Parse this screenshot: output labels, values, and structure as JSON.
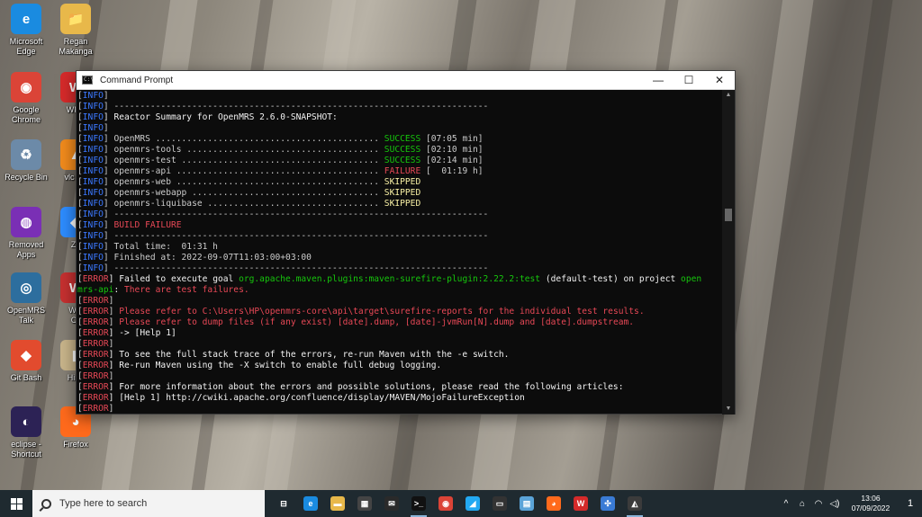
{
  "desktop": {
    "icons": [
      {
        "label": "Microsoft\nEdge",
        "glyph": "e",
        "color": "#1a8be0"
      },
      {
        "label": "Regan\nMakanga",
        "glyph": "📁",
        "color": "#e8b84a"
      },
      {
        "label": "Google\nChrome",
        "glyph": "◉",
        "color": "#db4437"
      },
      {
        "label": "WPS",
        "glyph": "W",
        "color": "#d52a2a"
      },
      {
        "label": "Recycle Bin",
        "glyph": "♻",
        "color": "#6c8aa8"
      },
      {
        "label": "vlc - S",
        "glyph": "▲",
        "color": "#f08a1c"
      },
      {
        "label": "Removed\nApps",
        "glyph": "◍",
        "color": "#7a2fb5"
      },
      {
        "label": "Zo",
        "glyph": "◆",
        "color": "#2d8cff"
      },
      {
        "label": "OpenMRS\nTalk",
        "glyph": "◎",
        "color": "#2d6e9e"
      },
      {
        "label": "WO\nCli",
        "glyph": "W",
        "color": "#c53030"
      },
      {
        "label": "Git Bash",
        "glyph": "◆",
        "color": "#e24b2e"
      },
      {
        "label": "Hibe",
        "glyph": "▮",
        "color": "#c8b48a"
      },
      {
        "label": "eclipse -\nShortcut",
        "glyph": "◐",
        "color": "#2c2255"
      },
      {
        "label": "Firefox",
        "glyph": "◕",
        "color": "#ff6a1c"
      }
    ]
  },
  "window": {
    "title": "Command Prompt",
    "minimize": "—",
    "maximize": "☐",
    "close": "✕"
  },
  "console": {
    "lines": [
      {
        "parts": [
          {
            "t": "[",
            "c": "grey"
          },
          {
            "t": "INFO",
            "c": "info"
          },
          {
            "t": "]",
            "c": "grey"
          }
        ]
      },
      {
        "parts": [
          {
            "t": "[",
            "c": "grey"
          },
          {
            "t": "INFO",
            "c": "info"
          },
          {
            "t": "] ------------------------------------------------------------------------",
            "c": "grey"
          }
        ]
      },
      {
        "parts": [
          {
            "t": "[",
            "c": "grey"
          },
          {
            "t": "INFO",
            "c": "info"
          },
          {
            "t": "] Reactor Summary for OpenMRS 2.6.0-SNAPSHOT:",
            "c": "white"
          }
        ]
      },
      {
        "parts": [
          {
            "t": "[",
            "c": "grey"
          },
          {
            "t": "INFO",
            "c": "info"
          },
          {
            "t": "]",
            "c": "grey"
          }
        ]
      },
      {
        "parts": [
          {
            "t": "[",
            "c": "grey"
          },
          {
            "t": "INFO",
            "c": "info"
          },
          {
            "t": "] OpenMRS ........................................... ",
            "c": "grey"
          },
          {
            "t": "SUCCESS",
            "c": "success"
          },
          {
            "t": " [07:05 min]",
            "c": "grey"
          }
        ]
      },
      {
        "parts": [
          {
            "t": "[",
            "c": "grey"
          },
          {
            "t": "INFO",
            "c": "info"
          },
          {
            "t": "] openmrs-tools ..................................... ",
            "c": "grey"
          },
          {
            "t": "SUCCESS",
            "c": "success"
          },
          {
            "t": " [02:10 min]",
            "c": "grey"
          }
        ]
      },
      {
        "parts": [
          {
            "t": "[",
            "c": "grey"
          },
          {
            "t": "INFO",
            "c": "info"
          },
          {
            "t": "] openmrs-test ...................................... ",
            "c": "grey"
          },
          {
            "t": "SUCCESS",
            "c": "success"
          },
          {
            "t": " [02:14 min]",
            "c": "grey"
          }
        ]
      },
      {
        "parts": [
          {
            "t": "[",
            "c": "grey"
          },
          {
            "t": "INFO",
            "c": "info"
          },
          {
            "t": "] openmrs-api ....................................... ",
            "c": "grey"
          },
          {
            "t": "FAILURE",
            "c": "red"
          },
          {
            "t": " [  01:19 h]",
            "c": "grey"
          }
        ]
      },
      {
        "parts": [
          {
            "t": "[",
            "c": "grey"
          },
          {
            "t": "INFO",
            "c": "info"
          },
          {
            "t": "] openmrs-web ....................................... ",
            "c": "grey"
          },
          {
            "t": "SKIPPED",
            "c": "warn"
          }
        ]
      },
      {
        "parts": [
          {
            "t": "[",
            "c": "grey"
          },
          {
            "t": "INFO",
            "c": "info"
          },
          {
            "t": "] openmrs-webapp .................................... ",
            "c": "grey"
          },
          {
            "t": "SKIPPED",
            "c": "warn"
          }
        ]
      },
      {
        "parts": [
          {
            "t": "[",
            "c": "grey"
          },
          {
            "t": "INFO",
            "c": "info"
          },
          {
            "t": "] openmrs-liquibase ................................. ",
            "c": "grey"
          },
          {
            "t": "SKIPPED",
            "c": "warn"
          }
        ]
      },
      {
        "parts": [
          {
            "t": "[",
            "c": "grey"
          },
          {
            "t": "INFO",
            "c": "info"
          },
          {
            "t": "] ------------------------------------------------------------------------",
            "c": "grey"
          }
        ]
      },
      {
        "parts": [
          {
            "t": "[",
            "c": "grey"
          },
          {
            "t": "INFO",
            "c": "info"
          },
          {
            "t": "] ",
            "c": "grey"
          },
          {
            "t": "BUILD FAILURE",
            "c": "red"
          }
        ]
      },
      {
        "parts": [
          {
            "t": "[",
            "c": "grey"
          },
          {
            "t": "INFO",
            "c": "info"
          },
          {
            "t": "] ------------------------------------------------------------------------",
            "c": "grey"
          }
        ]
      },
      {
        "parts": [
          {
            "t": "[",
            "c": "grey"
          },
          {
            "t": "INFO",
            "c": "info"
          },
          {
            "t": "] Total time:  01:31 h",
            "c": "grey"
          }
        ]
      },
      {
        "parts": [
          {
            "t": "[",
            "c": "grey"
          },
          {
            "t": "INFO",
            "c": "info"
          },
          {
            "t": "] Finished at: 2022-09-07T11:03:00+03:00",
            "c": "grey"
          }
        ]
      },
      {
        "parts": [
          {
            "t": "[",
            "c": "grey"
          },
          {
            "t": "INFO",
            "c": "info"
          },
          {
            "t": "] ------------------------------------------------------------------------",
            "c": "grey"
          }
        ]
      },
      {
        "parts": [
          {
            "t": "[",
            "c": "grey"
          },
          {
            "t": "ERROR",
            "c": "error"
          },
          {
            "t": "] Failed to execute goal ",
            "c": "white"
          },
          {
            "t": "org.apache.maven.plugins:maven-surefire-plugin:2.22.2:test",
            "c": "green"
          },
          {
            "t": " (default-test) on project ",
            "c": "white"
          },
          {
            "t": "open",
            "c": "green"
          }
        ]
      },
      {
        "parts": [
          {
            "t": "mrs-api",
            "c": "green"
          },
          {
            "t": ": ",
            "c": "white"
          },
          {
            "t": "There are test failures.",
            "c": "red"
          }
        ]
      },
      {
        "parts": [
          {
            "t": "[",
            "c": "grey"
          },
          {
            "t": "ERROR",
            "c": "error"
          },
          {
            "t": "]",
            "c": "grey"
          }
        ]
      },
      {
        "parts": [
          {
            "t": "[",
            "c": "grey"
          },
          {
            "t": "ERROR",
            "c": "error"
          },
          {
            "t": "] ",
            "c": "grey"
          },
          {
            "t": "Please refer to C:\\Users\\HP\\openmrs-core\\api\\target\\surefire-reports for the individual test results.",
            "c": "red"
          }
        ]
      },
      {
        "parts": [
          {
            "t": "[",
            "c": "grey"
          },
          {
            "t": "ERROR",
            "c": "error"
          },
          {
            "t": "] ",
            "c": "grey"
          },
          {
            "t": "Please refer to dump files (if any exist) [date].dump, [date]-jvmRun[N].dump and [date].dumpstream.",
            "c": "red"
          }
        ]
      },
      {
        "parts": [
          {
            "t": "[",
            "c": "grey"
          },
          {
            "t": "ERROR",
            "c": "error"
          },
          {
            "t": "] -> [Help 1]",
            "c": "white"
          }
        ]
      },
      {
        "parts": [
          {
            "t": "[",
            "c": "grey"
          },
          {
            "t": "ERROR",
            "c": "error"
          },
          {
            "t": "]",
            "c": "grey"
          }
        ]
      },
      {
        "parts": [
          {
            "t": "[",
            "c": "grey"
          },
          {
            "t": "ERROR",
            "c": "error"
          },
          {
            "t": "] To see the full stack trace of the errors, re-run Maven with the -e switch.",
            "c": "white"
          }
        ]
      },
      {
        "parts": [
          {
            "t": "[",
            "c": "grey"
          },
          {
            "t": "ERROR",
            "c": "error"
          },
          {
            "t": "] Re-run Maven using the -X switch to enable full debug logging.",
            "c": "white"
          }
        ]
      },
      {
        "parts": [
          {
            "t": "[",
            "c": "grey"
          },
          {
            "t": "ERROR",
            "c": "error"
          },
          {
            "t": "]",
            "c": "grey"
          }
        ]
      },
      {
        "parts": [
          {
            "t": "[",
            "c": "grey"
          },
          {
            "t": "ERROR",
            "c": "error"
          },
          {
            "t": "] For more information about the errors and possible solutions, please read the following articles:",
            "c": "white"
          }
        ]
      },
      {
        "parts": [
          {
            "t": "[",
            "c": "grey"
          },
          {
            "t": "ERROR",
            "c": "error"
          },
          {
            "t": "] [Help 1] http://cwiki.apache.org/confluence/display/MAVEN/MojoFailureException",
            "c": "white"
          }
        ]
      },
      {
        "parts": [
          {
            "t": "[",
            "c": "grey"
          },
          {
            "t": "ERROR",
            "c": "error"
          },
          {
            "t": "]",
            "c": "grey"
          }
        ]
      }
    ]
  },
  "taskbar": {
    "search_placeholder": "Type here to search",
    "apps": [
      {
        "name": "task-view",
        "glyph": "⊟",
        "color": "transparent",
        "active": false
      },
      {
        "name": "edge",
        "glyph": "e",
        "color": "#1a8be0",
        "active": false
      },
      {
        "name": "file-explorer",
        "glyph": "▬",
        "color": "#e8b84a",
        "active": false
      },
      {
        "name": "store",
        "glyph": "▦",
        "color": "#444",
        "active": false
      },
      {
        "name": "mail",
        "glyph": "✉",
        "color": "#2a2a2a",
        "active": false
      },
      {
        "name": "command-prompt",
        "glyph": ">_",
        "color": "#111",
        "active": true
      },
      {
        "name": "chrome",
        "glyph": "◉",
        "color": "#db4437",
        "active": false
      },
      {
        "name": "vscode",
        "glyph": "◢",
        "color": "#23a9f2",
        "active": false
      },
      {
        "name": "terminal",
        "glyph": "▭",
        "color": "#333",
        "active": false
      },
      {
        "name": "notepad",
        "glyph": "▤",
        "color": "#5ba4d8",
        "active": false
      },
      {
        "name": "firefox",
        "glyph": "◕",
        "color": "#ff6a1c",
        "active": false
      },
      {
        "name": "wps",
        "glyph": "W",
        "color": "#d52a2a",
        "active": false
      },
      {
        "name": "app-grid",
        "glyph": "✣",
        "color": "#3a7bd5",
        "active": false
      },
      {
        "name": "photos",
        "glyph": "◭",
        "color": "#3b3b3b",
        "active": true
      }
    ],
    "tray": {
      "chevron": "^",
      "network": "⌂",
      "wifi": "◠",
      "volume": "◁)",
      "time": "13:06",
      "date": "07/09/2022",
      "notifications": "1"
    }
  }
}
